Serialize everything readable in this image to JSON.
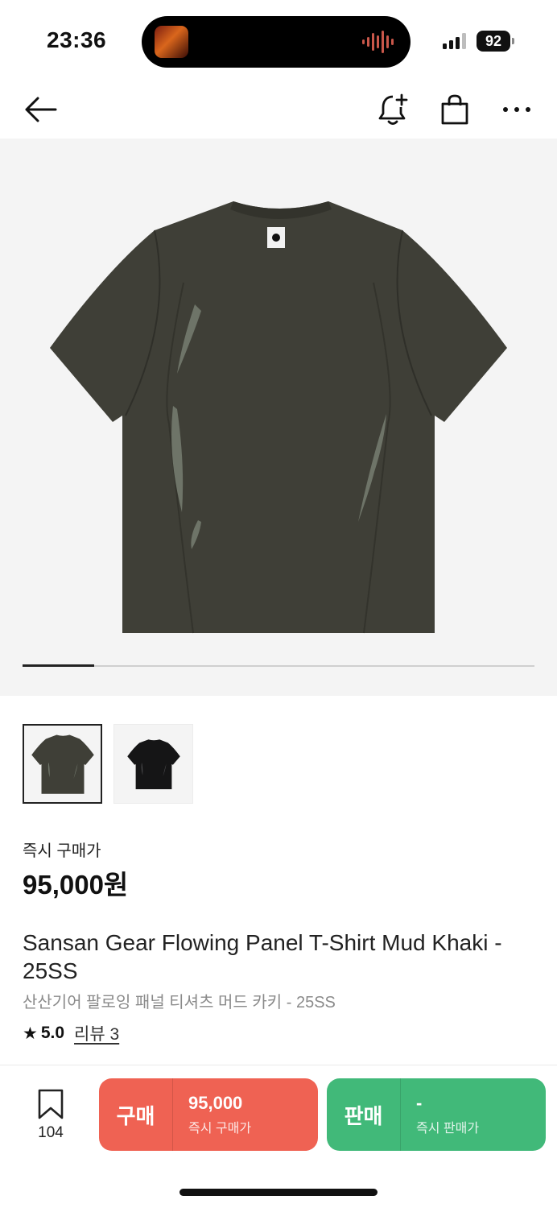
{
  "status_bar": {
    "time": "23:36",
    "battery": "92"
  },
  "product": {
    "price_label": "즉시 구매가",
    "price": "95,000원",
    "title_en": "Sansan Gear Flowing Panel T-Shirt Mud Khaki - 25SS",
    "title_ko": "산산기어 팔로잉 패널 티셔츠 머드 카키 - 25SS",
    "rating_score": "5.0",
    "review_label": "리뷰 3",
    "image_progress": 0.14
  },
  "gallery": {
    "thumbnails": [
      {
        "color": "#3f3f37",
        "selected": true
      },
      {
        "color": "#151516",
        "selected": false
      }
    ]
  },
  "bottom_bar": {
    "wish_count": "104",
    "buy": {
      "label": "구매",
      "price": "95,000",
      "sub": "즉시 구매가"
    },
    "sell": {
      "label": "판매",
      "price": "-",
      "sub": "즉시 판매가"
    }
  },
  "colors": {
    "buy": "#ef6253",
    "sell": "#41b979",
    "shirt": "#3f3f37"
  }
}
